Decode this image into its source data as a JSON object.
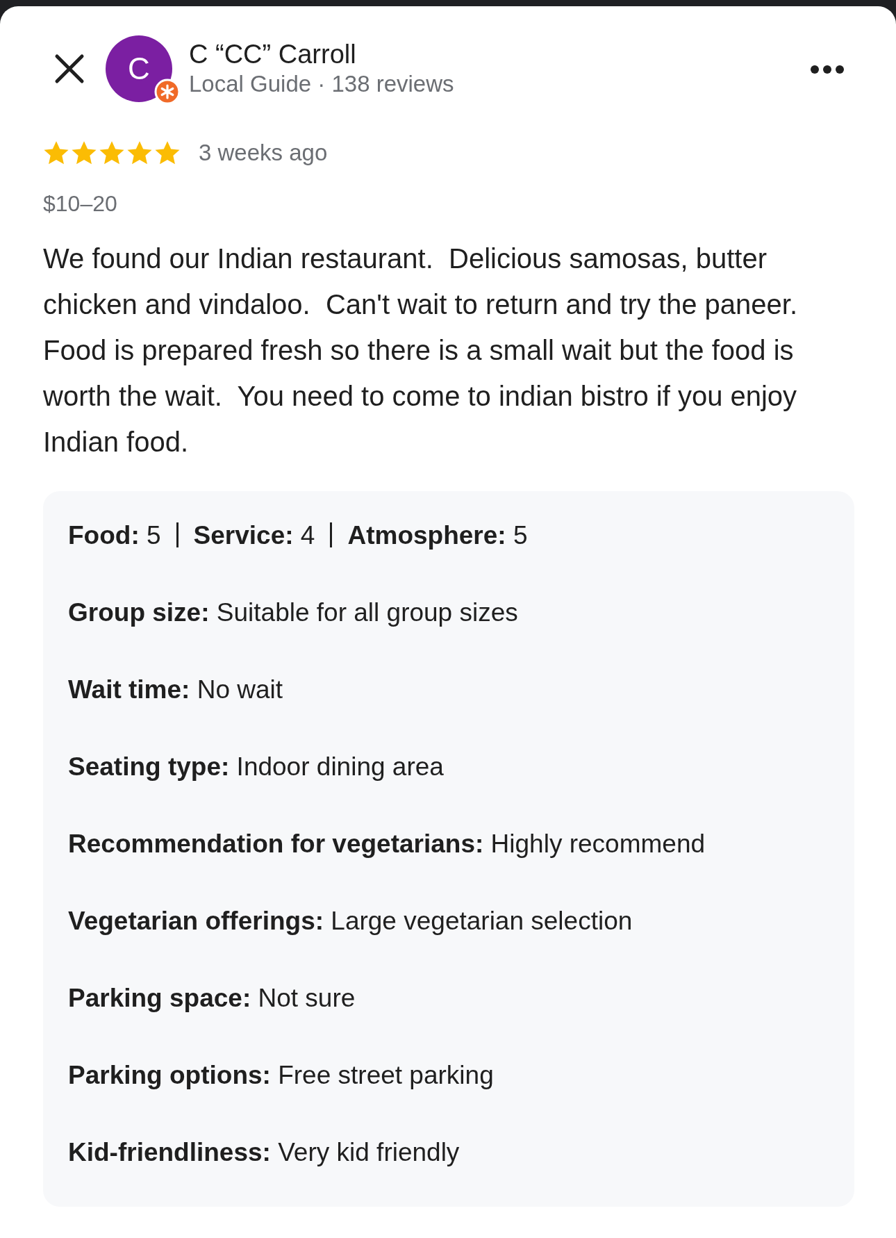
{
  "reviewer": {
    "initial": "C",
    "name": "C “CC” Carroll",
    "subtitle": "Local Guide · 138 reviews",
    "local_guide": true
  },
  "review": {
    "stars": 5,
    "time": "3 weeks ago",
    "price": "$10–20",
    "text": "We found our Indian restaurant.  Delicious samosas, butter chicken and vindaloo.  Can't wait to return and try the paneer.  Food is prepared fresh so there is a small wait but the food is worth the wait.  You need to come to indian bistro if you enjoy Indian food."
  },
  "ratings": [
    {
      "label": "Food:",
      "value": "5"
    },
    {
      "label": "Service:",
      "value": "4"
    },
    {
      "label": "Atmosphere:",
      "value": "5"
    }
  ],
  "attributes": [
    {
      "label": "Group size:",
      "value": "Suitable for all group sizes"
    },
    {
      "label": "Wait time:",
      "value": "No wait"
    },
    {
      "label": "Seating type:",
      "value": "Indoor dining area"
    },
    {
      "label": "Recommendation for vegetarians:",
      "value": "Highly recommend"
    },
    {
      "label": "Vegetarian offerings:",
      "value": "Large vegetarian selection"
    },
    {
      "label": "Parking space:",
      "value": "Not sure"
    },
    {
      "label": "Parking options:",
      "value": "Free street parking"
    },
    {
      "label": "Kid-friendliness:",
      "value": "Very kid friendly"
    }
  ]
}
